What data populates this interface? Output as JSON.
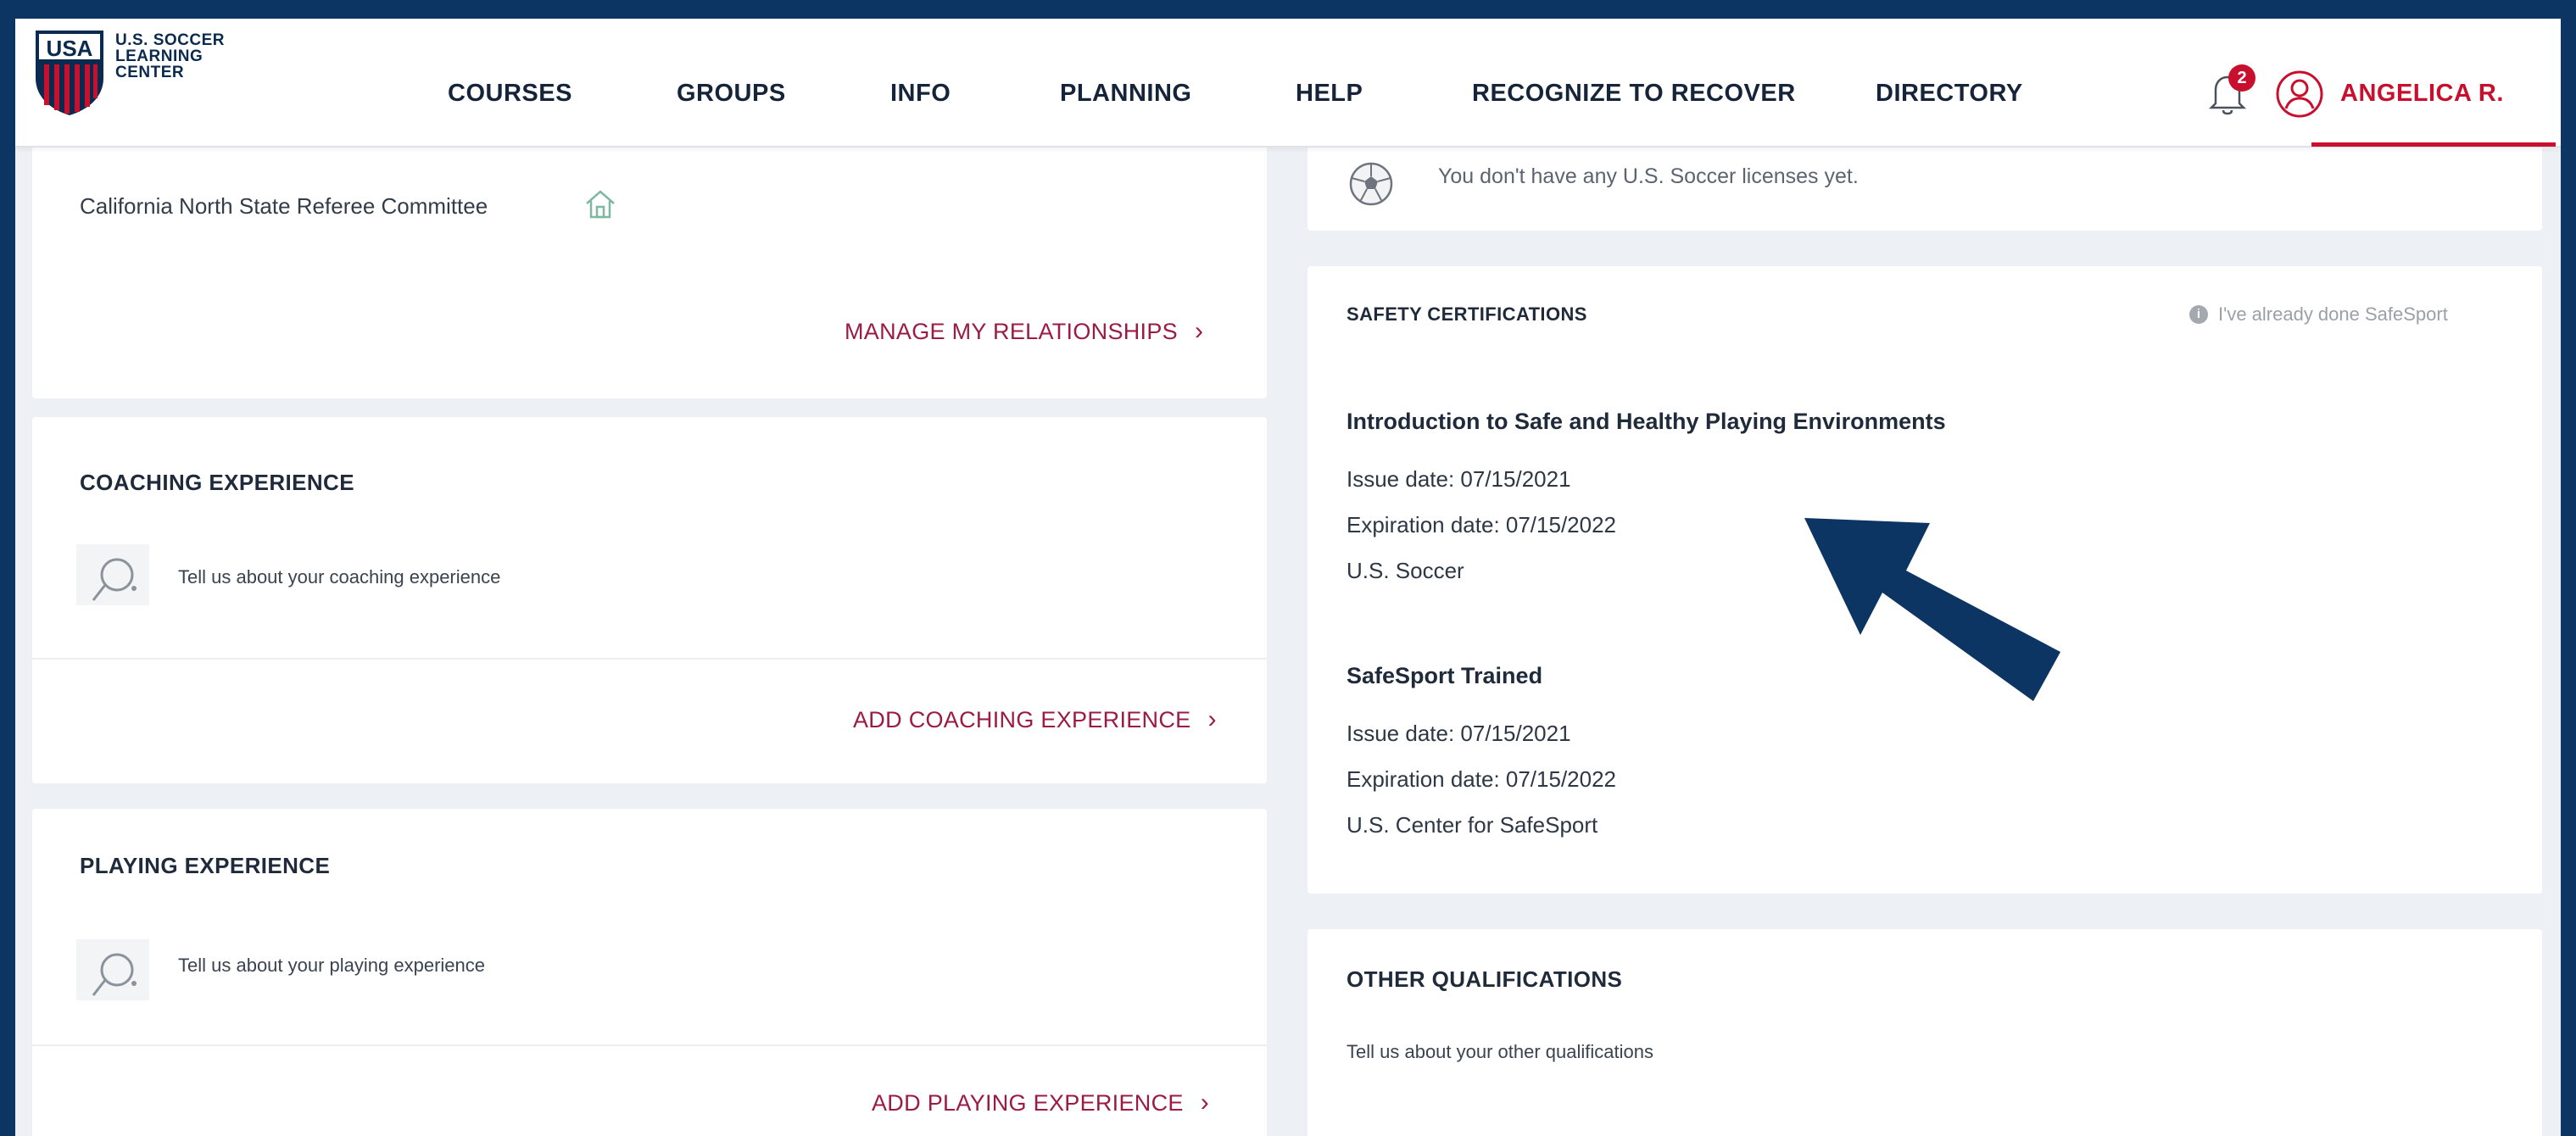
{
  "brand": {
    "logo_line1": "U.S. SOCCER",
    "logo_line2": "LEARNING",
    "logo_line3": "CENTER"
  },
  "nav": {
    "courses": "COURSES",
    "groups": "GROUPS",
    "info": "INFO",
    "planning": "PLANNING",
    "help": "HELP",
    "recognize": "RECOGNIZE TO RECOVER",
    "directory": "DIRECTORY",
    "notification_count": "2",
    "user_name": "ANGELICA R."
  },
  "relationships": {
    "org_name": "California North State Referee Committee",
    "manage_link": "MANAGE MY RELATIONSHIPS"
  },
  "coaching": {
    "title": "COACHING EXPERIENCE",
    "prompt": "Tell us about your coaching experience",
    "add_link": "ADD COACHING EXPERIENCE"
  },
  "playing": {
    "title": "PLAYING EXPERIENCE",
    "prompt": "Tell us about your playing experience",
    "add_link": "ADD PLAYING EXPERIENCE"
  },
  "licenses": {
    "message": "You don't have any U.S. Soccer licenses yet."
  },
  "safety": {
    "title": "SAFETY CERTIFICATIONS",
    "already_done": "I've already done SafeSport",
    "certs": [
      {
        "name": "Introduction to Safe and Healthy Playing Environments",
        "issue": "Issue date: 07/15/2021",
        "expiration": "Expiration date: 07/15/2022",
        "issuer": "U.S. Soccer"
      },
      {
        "name": "SafeSport Trained",
        "issue": "Issue date: 07/15/2021",
        "expiration": "Expiration date: 07/15/2022",
        "issuer": "U.S. Center for SafeSport"
      }
    ]
  },
  "other": {
    "title": "OTHER QUALIFICATIONS",
    "prompt": "Tell us about your other qualifications"
  },
  "colors": {
    "frame": "#0d3563",
    "accent_red": "#c8102e",
    "link_maroon": "#9b1b44",
    "arrow": "#0d3563"
  }
}
